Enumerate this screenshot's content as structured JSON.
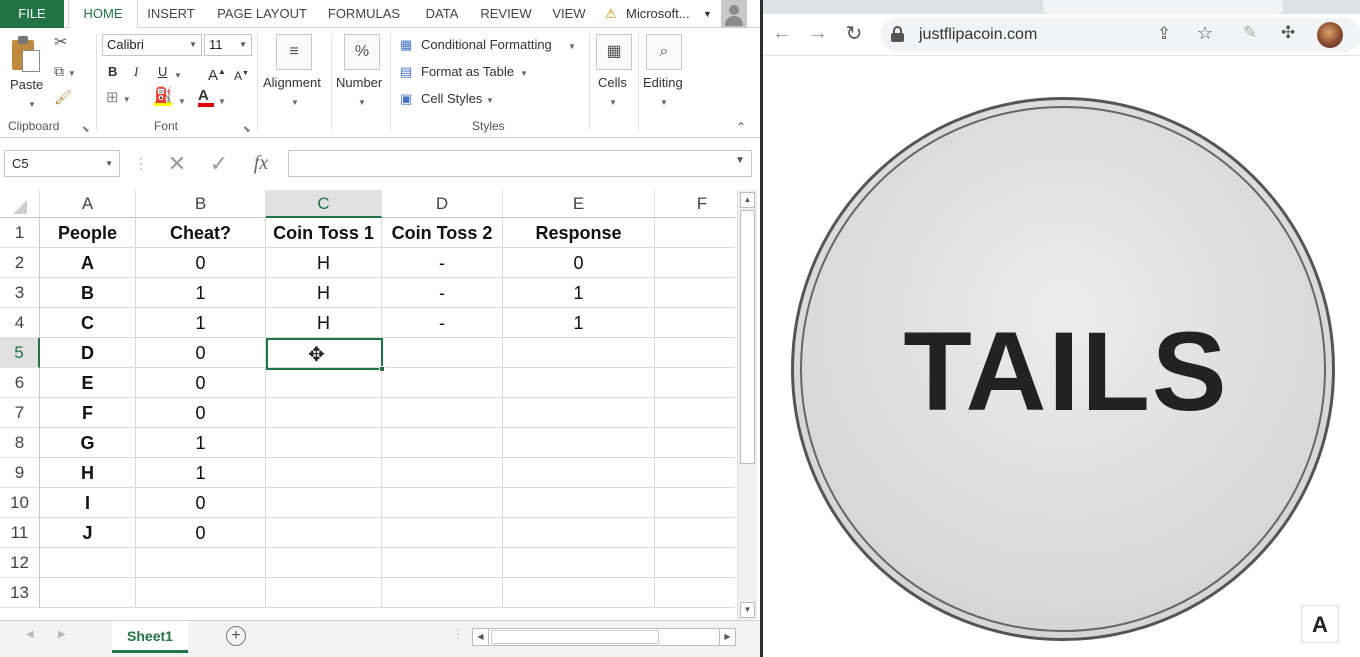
{
  "excel": {
    "tabs": [
      "FILE",
      "HOME",
      "INSERT",
      "PAGE LAYOUT",
      "FORMULAS",
      "DATA",
      "REVIEW",
      "VIEW"
    ],
    "window_title": "Microsoft...",
    "clipboard": {
      "paste": "Paste",
      "group": "Clipboard"
    },
    "font": {
      "name": "Calibri",
      "size": "11",
      "group": "Font",
      "bold": "B",
      "italic": "I",
      "underline": "U",
      "grow": "A",
      "shrink": "A",
      "fill_letter": "A"
    },
    "alignment": {
      "label": "Alignment",
      "icon": "≡"
    },
    "number": {
      "label": "Number",
      "icon": "%"
    },
    "styles": {
      "conditional": "Conditional Formatting",
      "format_table": "Format as Table",
      "cell_styles": "Cell Styles",
      "group": "Styles"
    },
    "cells": {
      "label": "Cells"
    },
    "editing": {
      "label": "Editing"
    },
    "name_box": "C5",
    "formula": "",
    "fx": "fx",
    "columns": [
      "A",
      "B",
      "C",
      "D",
      "E",
      "F"
    ],
    "selected_column": "C",
    "selected_row": "5",
    "rows": [
      {
        "num": "1",
        "cells": [
          "People",
          "Cheat?",
          "Coin Toss 1",
          "Coin Toss 2",
          "Response",
          ""
        ]
      },
      {
        "num": "2",
        "cells": [
          "A",
          "0",
          "H",
          "-",
          "0",
          ""
        ]
      },
      {
        "num": "3",
        "cells": [
          "B",
          "1",
          "H",
          "-",
          "1",
          ""
        ]
      },
      {
        "num": "4",
        "cells": [
          "C",
          "1",
          "H",
          "-",
          "1",
          ""
        ]
      },
      {
        "num": "5",
        "cells": [
          "D",
          "0",
          "",
          "",
          "",
          ""
        ]
      },
      {
        "num": "6",
        "cells": [
          "E",
          "0",
          "",
          "",
          "",
          ""
        ]
      },
      {
        "num": "7",
        "cells": [
          "F",
          "0",
          "",
          "",
          "",
          ""
        ]
      },
      {
        "num": "8",
        "cells": [
          "G",
          "1",
          "",
          "",
          "",
          ""
        ]
      },
      {
        "num": "9",
        "cells": [
          "H",
          "1",
          "",
          "",
          "",
          ""
        ]
      },
      {
        "num": "10",
        "cells": [
          "I",
          "0",
          "",
          "",
          "",
          ""
        ]
      },
      {
        "num": "11",
        "cells": [
          "J",
          "0",
          "",
          "",
          "",
          ""
        ]
      },
      {
        "num": "12",
        "cells": [
          "",
          "",
          "",
          "",
          "",
          ""
        ]
      },
      {
        "num": "13",
        "cells": [
          "",
          "",
          "",
          "",
          "",
          ""
        ]
      }
    ],
    "sheet_tab": "Sheet1",
    "accent": "#217346"
  },
  "browser": {
    "url": "justflipacoin.com",
    "coin_text": "TAILS",
    "logo_letter": "A"
  }
}
